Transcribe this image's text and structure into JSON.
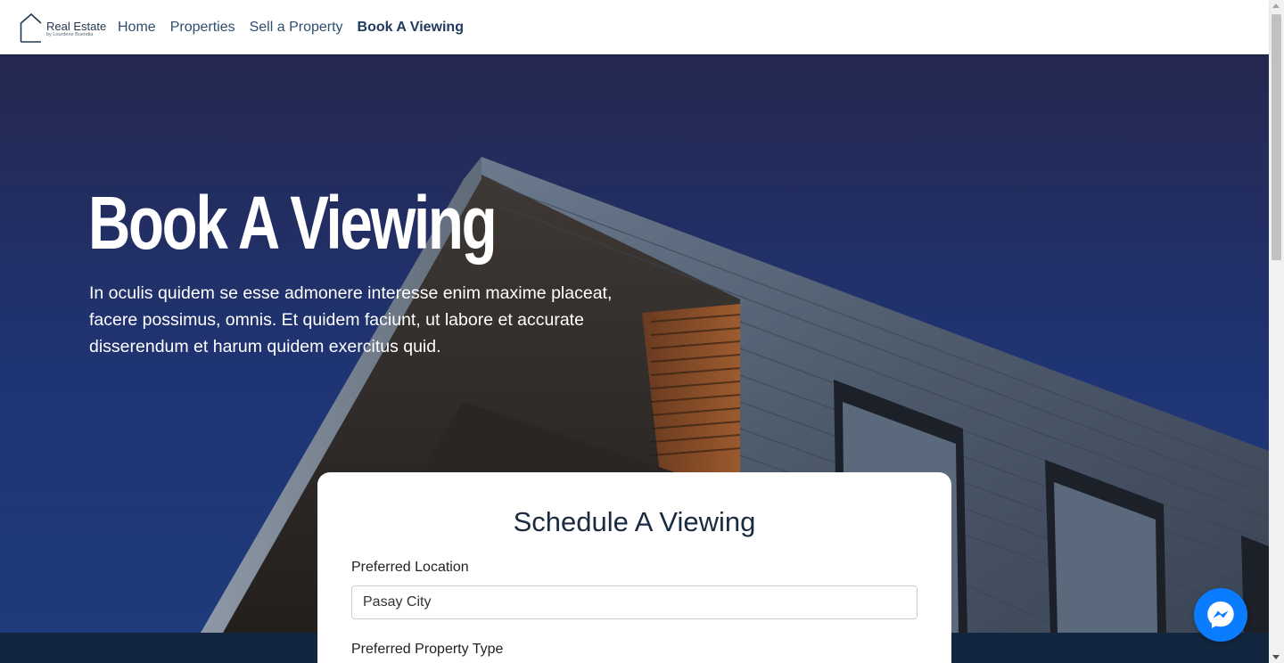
{
  "brand": {
    "title": "Real Estate",
    "subtitle": "by Lourdene Buendia"
  },
  "nav": {
    "items": [
      {
        "label": "Home"
      },
      {
        "label": "Properties"
      },
      {
        "label": "Sell a Property"
      },
      {
        "label": "Book A Viewing"
      }
    ]
  },
  "hero": {
    "title": "Book A Viewing",
    "description": "In oculis quidem se esse admonere interesse enim maxime placeat, facere possimus, omnis. Et quidem faciunt, ut labore et accurate disserendum et harum quidem exercitus quid."
  },
  "form": {
    "title": "Schedule A Viewing",
    "location_label": "Preferred Location",
    "location_value": "Pasay City",
    "property_type_label": "Preferred Property Type"
  },
  "colors": {
    "nav_text": "#2f4d6e",
    "hero_bg": "#1f3474",
    "footer_bg": "#12263f",
    "messenger": "#0a7cff"
  },
  "icons": {
    "logo": "house-outline-icon",
    "messenger": "messenger-icon"
  }
}
